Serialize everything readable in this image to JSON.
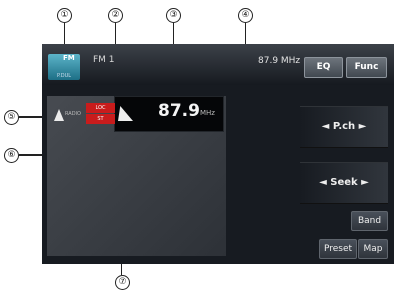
{
  "callouts": [
    {
      "number": "①"
    },
    {
      "number": "②"
    },
    {
      "number": "③"
    },
    {
      "number": "④"
    },
    {
      "number": "⑤"
    },
    {
      "number": "⑥"
    },
    {
      "number": "⑦"
    }
  ],
  "header": {
    "source_icon_label": "FM",
    "source_icon_sublabel": "P.DUL",
    "band": "FM 1",
    "frequency": "87.9 MHz",
    "buttons": {
      "eq": "EQ",
      "func": "Func"
    }
  },
  "main": {
    "radio_label": "RADIO",
    "indicators": {
      "top": "LOC",
      "bottom": "ST"
    },
    "frequency_value": "87.9",
    "frequency_unit": "MHz"
  },
  "side_controls": {
    "pch": "◄  P.ch  ►",
    "seek": "◄  Seek  ►"
  },
  "bottom_buttons": {
    "band": "Band",
    "preset": "Preset",
    "map": "Map"
  },
  "colors": {
    "screen_bg": "#171b21",
    "indicator_red": "#c91c1c",
    "accent_cyan": "#5cb4c9"
  }
}
